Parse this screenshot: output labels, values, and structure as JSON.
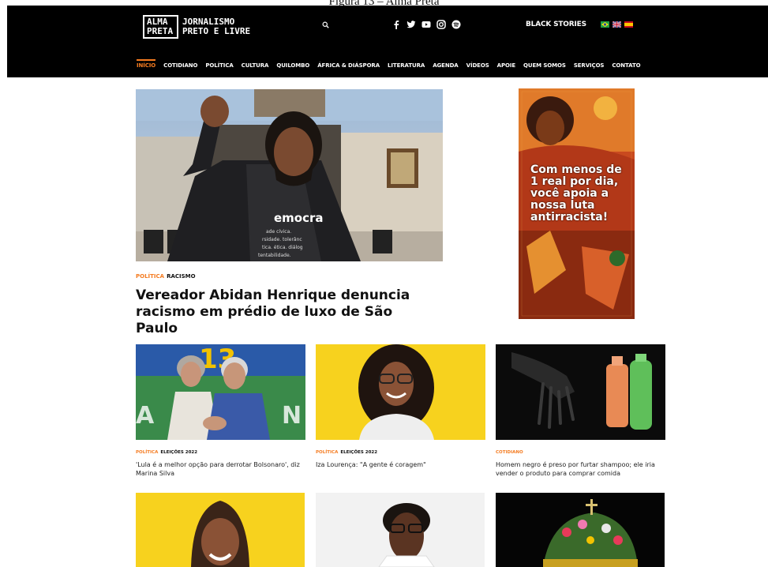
{
  "caption": "Figura 13 – Alma Preta",
  "header": {
    "logo_line1": "ALMA",
    "logo_line2": "PRETA",
    "tagline_1": "JORNALISMO",
    "tagline_2": "PRETO E LIVRE",
    "black_stories": "BLACK STORIES",
    "social_icons": [
      "facebook-icon",
      "twitter-icon",
      "youtube-icon",
      "instagram-icon",
      "spotify-icon"
    ],
    "flags": [
      "brazil-flag",
      "uk-flag",
      "spain-flag"
    ]
  },
  "nav": {
    "items": [
      "INÍCIO",
      "COTIDIANO",
      "POLÍTICA",
      "CULTURA",
      "QUILOMBO",
      "ÁFRICA & DIÁSPORA",
      "LITERATURA",
      "AGENDA",
      "VÍDEOS",
      "APOIE",
      "QUEM SOMOS",
      "SERVIÇOS",
      "CONTATO"
    ],
    "active": "INÍCIO"
  },
  "hero": {
    "category1": "POLÍTICA",
    "category2": "RACISMO",
    "title": "Vereador Abidan Henrique denuncia racismo em prédio de luxo de São Paulo",
    "shirt_text": "emocra"
  },
  "ad": {
    "text": "Com menos de 1 real por dia, você apoia a nossa luta antirracista!"
  },
  "cards": [
    {
      "category1": "POLÍTICA",
      "category2": "ELEIÇÕES 2022",
      "title": "'Lula é a melhor opção para derrotar Bolsonaro', diz Marina Silva"
    },
    {
      "category1": "POLÍTICA",
      "category2": "ELEIÇÕES 2022",
      "title": "Iza Lourença: \"A gente é coragem\""
    },
    {
      "category1": "COTIDIANO",
      "category2": "",
      "title": "Homem negro é preso por furtar shampoo; ele iria vender o produto para comprar comida"
    }
  ],
  "colors": {
    "accent": "#f47b20",
    "header_bg": "#000000",
    "yellow": "#f7d21e"
  }
}
